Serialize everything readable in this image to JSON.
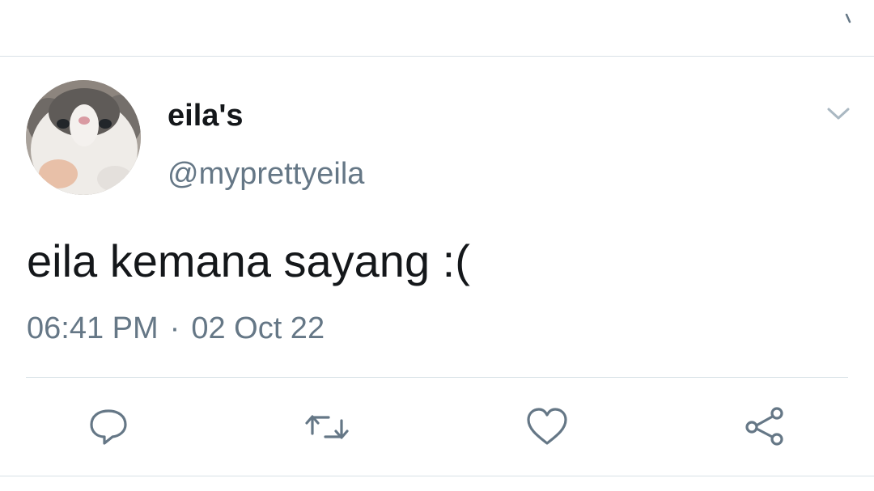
{
  "tweet": {
    "display_name": "eila's",
    "handle": "@myprettyeila",
    "text": "eila kemana sayang :(",
    "time": "06:41 PM",
    "separator": "·",
    "date": "02 Oct 22"
  },
  "icons": {
    "top": "tick-icon",
    "menu": "chevron-down-icon",
    "reply": "reply-icon",
    "retweet": "retweet-icon",
    "like": "heart-icon",
    "share": "share-icon"
  },
  "colors": {
    "text_primary": "#14171a",
    "text_secondary": "#657786",
    "icon": "#657786",
    "divider": "#d8e1e6",
    "background": "#ffffff"
  }
}
